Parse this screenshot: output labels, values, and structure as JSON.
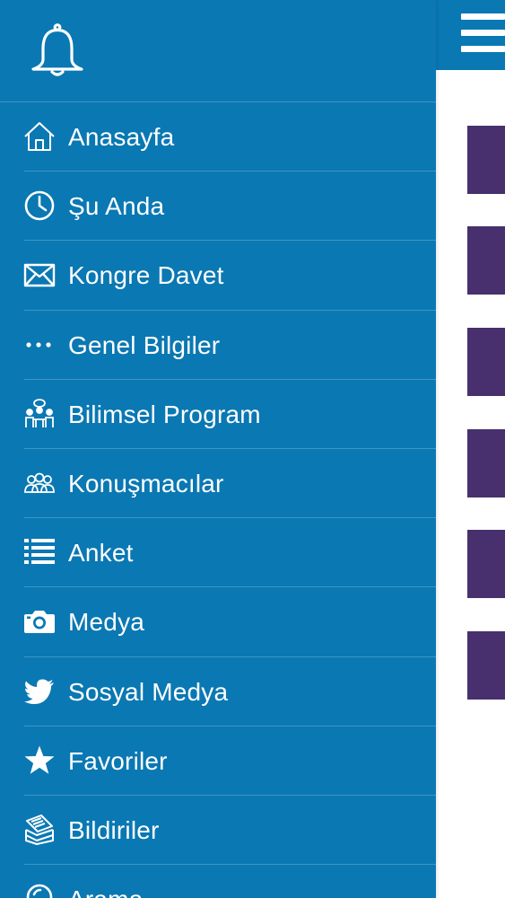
{
  "colors": {
    "drawer_background": "#0a78b3",
    "topbar_background": "#0a78b3",
    "tile_color": "#47306d",
    "text": "#ffffff"
  },
  "drawer": {
    "header_icon": "bell-icon",
    "items": [
      {
        "label": "Anasayfa",
        "icon": "home-icon"
      },
      {
        "label": "Şu Anda",
        "icon": "clock-icon"
      },
      {
        "label": "Kongre Davet",
        "icon": "envelope-icon"
      },
      {
        "label": "Genel Bilgiler",
        "icon": "more-dots-icon"
      },
      {
        "label": "Bilimsel Program",
        "icon": "meeting-icon"
      },
      {
        "label": "Konuşmacılar",
        "icon": "people-icon"
      },
      {
        "label": "Anket",
        "icon": "list-icon"
      },
      {
        "label": "Medya",
        "icon": "camera-icon"
      },
      {
        "label": "Sosyal Medya",
        "icon": "twitter-icon"
      },
      {
        "label": "Favoriler",
        "icon": "star-icon"
      },
      {
        "label": "Bildiriler",
        "icon": "papers-icon"
      },
      {
        "label": "Arama",
        "icon": "search-icon"
      }
    ]
  },
  "topbar": {
    "menu_icon": "hamburger-menu-icon"
  }
}
